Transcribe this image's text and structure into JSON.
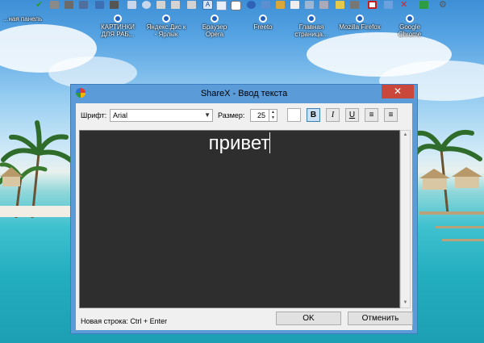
{
  "desktop": {
    "icons": [
      {
        "label": "...ная панель"
      },
      {
        "label": "КАРТИНКИ ДЛЯ РАБ..."
      },
      {
        "label": "Яндекс.Дис к - Ярлык"
      },
      {
        "label": "Браузер Opera"
      },
      {
        "label": "Freeto"
      },
      {
        "label": "Главная страница..."
      },
      {
        "label": "Mozilla Firefox"
      },
      {
        "label": "Google Chrome"
      }
    ]
  },
  "window": {
    "title": "ShareX - Ввод текста",
    "close_glyph": "✕",
    "font_label": "Шрифт:",
    "font_value": "Arial",
    "size_label": "Размер:",
    "size_value": "25",
    "bold_label": "B",
    "italic_label": "I",
    "underline_label": "U",
    "align_center_glyph": "≡",
    "align_right_glyph": "≡",
    "text_value": "привет",
    "hint": "Новая строка: Ctrl + Enter",
    "ok_label": "OK",
    "cancel_label": "Отменить"
  },
  "colors": {
    "titlebar": "#5a9bd8",
    "close": "#c9473b",
    "editor_bg": "#2e2e2e",
    "editor_text": "#ffffff"
  }
}
